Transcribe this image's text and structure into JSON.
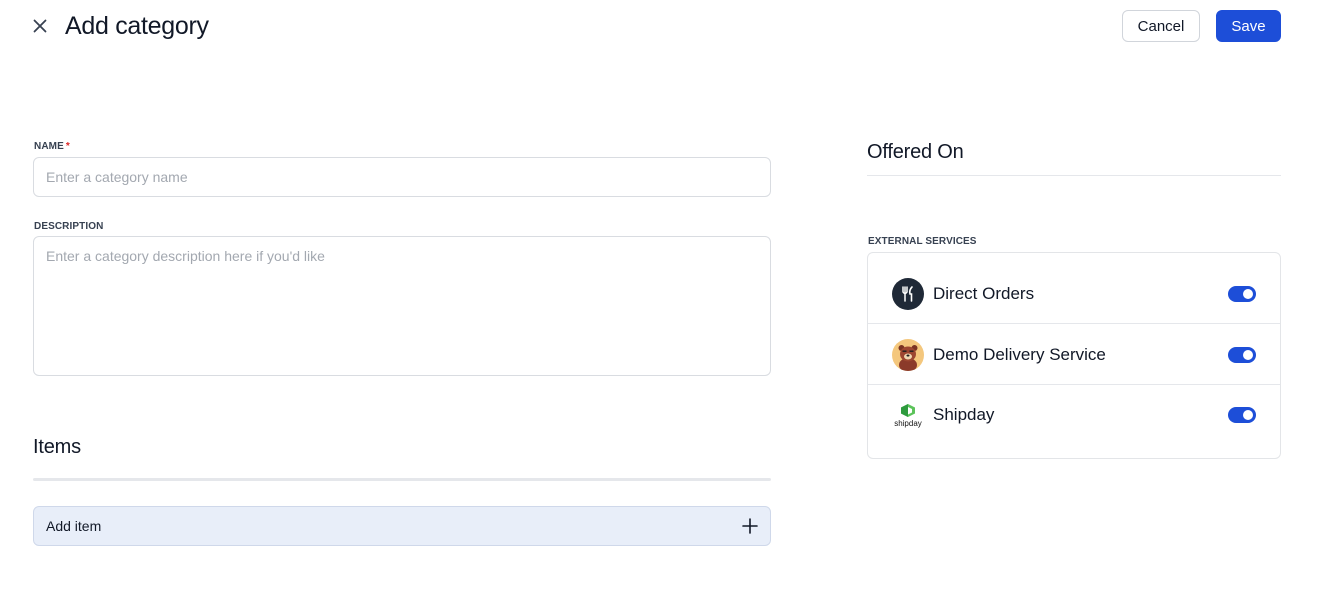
{
  "header": {
    "title": "Add category",
    "cancel_label": "Cancel",
    "save_label": "Save"
  },
  "form": {
    "name": {
      "label": "NAME",
      "required_mark": "*",
      "value": "",
      "placeholder": "Enter a category name"
    },
    "description": {
      "label": "DESCRIPTION",
      "value": "",
      "placeholder": "Enter a category description here if you'd like"
    }
  },
  "items": {
    "title": "Items",
    "add_label": "Add item"
  },
  "offered_on": {
    "title": "Offered On",
    "external_label": "EXTERNAL SERVICES",
    "services": [
      {
        "name": "Direct Orders",
        "enabled": true,
        "icon": "fork-knife-icon"
      },
      {
        "name": "Demo Delivery Service",
        "enabled": true,
        "icon": "bear-mascot-icon"
      },
      {
        "name": "Shipday",
        "enabled": true,
        "icon": "shipday-logo-icon",
        "logo_text": "shipday"
      }
    ]
  },
  "colors": {
    "accent": "#1d4ed8",
    "required": "#dc2626",
    "add_item_bg": "#e8eef9"
  }
}
